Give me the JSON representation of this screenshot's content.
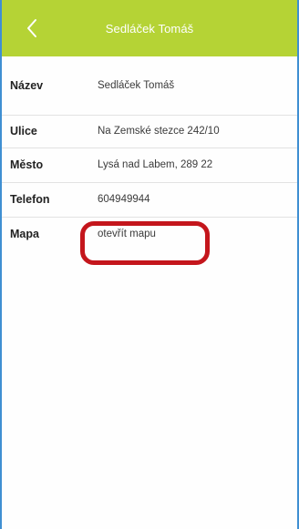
{
  "header": {
    "title": "Sedláček Tomáš",
    "back_icon": "chevron-left-icon"
  },
  "details": [
    {
      "key": "nazev",
      "label": "Název",
      "value": "Sedláček Tomáš"
    },
    {
      "key": "ulice",
      "label": "Ulice",
      "value": "Na Zemské stezce 242/10"
    },
    {
      "key": "mesto",
      "label": "Město",
      "value": "Lysá nad Labem, 289 22"
    },
    {
      "key": "telefon",
      "label": "Telefon",
      "value": "604949944"
    },
    {
      "key": "mapa",
      "label": "Mapa",
      "value": "otevřít mapu"
    }
  ],
  "colors": {
    "header_bg": "#b5d335",
    "highlight": "#c4161c",
    "frame_border": "#3f8fd2"
  }
}
